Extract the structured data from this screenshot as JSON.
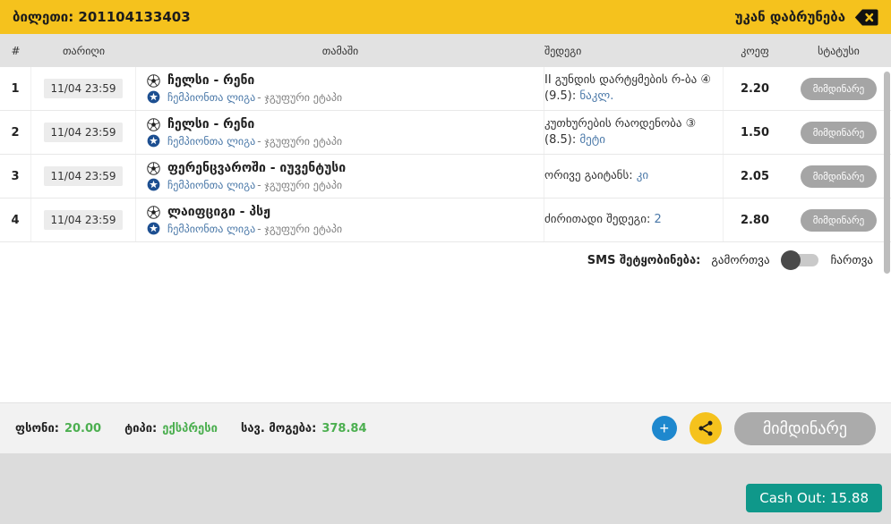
{
  "colors": {
    "accent_yellow": "#F5C21D",
    "link_blue": "#4A78A8",
    "value_green": "#4CAF50",
    "cashout_teal": "#0F988A",
    "add_blue": "#1E88CE",
    "status_gray": "#A5A5A5"
  },
  "header": {
    "ticket_title": "ბილეთი: 201104133403",
    "back_label": "უკან დაბრუნება"
  },
  "table": {
    "columns": [
      "#",
      "თარიღი",
      "თამაში",
      "შედეგი",
      "კოეფ",
      "სტატუსი"
    ],
    "rows": [
      {
        "num": "1",
        "date": "11/04 23:59",
        "teams": "ჩელსი - რენი",
        "league": "ჩემპიონთა ლიგა",
        "stage": "- ჯგუფური ეტაპი",
        "market": "II გუნდის დარტყმების რ-ბა ④ (9.5): ",
        "pick": "ნაკლ.",
        "odds": "2.20",
        "status": "მიმდინარე"
      },
      {
        "num": "2",
        "date": "11/04 23:59",
        "teams": "ჩელსი - რენი",
        "league": "ჩემპიონთა ლიგა",
        "stage": "- ჯგუფური ეტაპი",
        "market": "კუთხურების რაოდენობა ③ (8.5): ",
        "pick": "მეტი",
        "odds": "1.50",
        "status": "მიმდინარე"
      },
      {
        "num": "3",
        "date": "11/04 23:59",
        "teams": "ფერენცვაროში - იუვენტუსი",
        "league": "ჩემპიონთა ლიგა",
        "stage": "- ჯგუფური ეტაპი",
        "market": "ორივე გაიტანს: ",
        "pick": "კი",
        "odds": "2.05",
        "status": "მიმდინარე"
      },
      {
        "num": "4",
        "date": "11/04 23:59",
        "teams": "ლაიფციგი - პსჟ",
        "league": "ჩემპიონთა ლიგა",
        "stage": "- ჯგუფური ეტაპი",
        "market": "ძირითადი შედეგი: ",
        "pick": "2",
        "odds": "2.80",
        "status": "მიმდინარე"
      }
    ]
  },
  "sms": {
    "label": "SMS შეტყობინება:",
    "off_label": "გამორთვა",
    "on_label": "ჩართვა",
    "state": "off"
  },
  "summary": {
    "stake_label": "ფსონი:",
    "stake_value": "20.00",
    "type_label": "ტიპი:",
    "type_value": "ექსპრესი",
    "payout_label": "სავ. მოგება:",
    "payout_value": "378.84",
    "add_button": "+",
    "status_button": "მიმდინარე"
  },
  "footer": {
    "cashout_label": "Cash Out: 15.88"
  }
}
